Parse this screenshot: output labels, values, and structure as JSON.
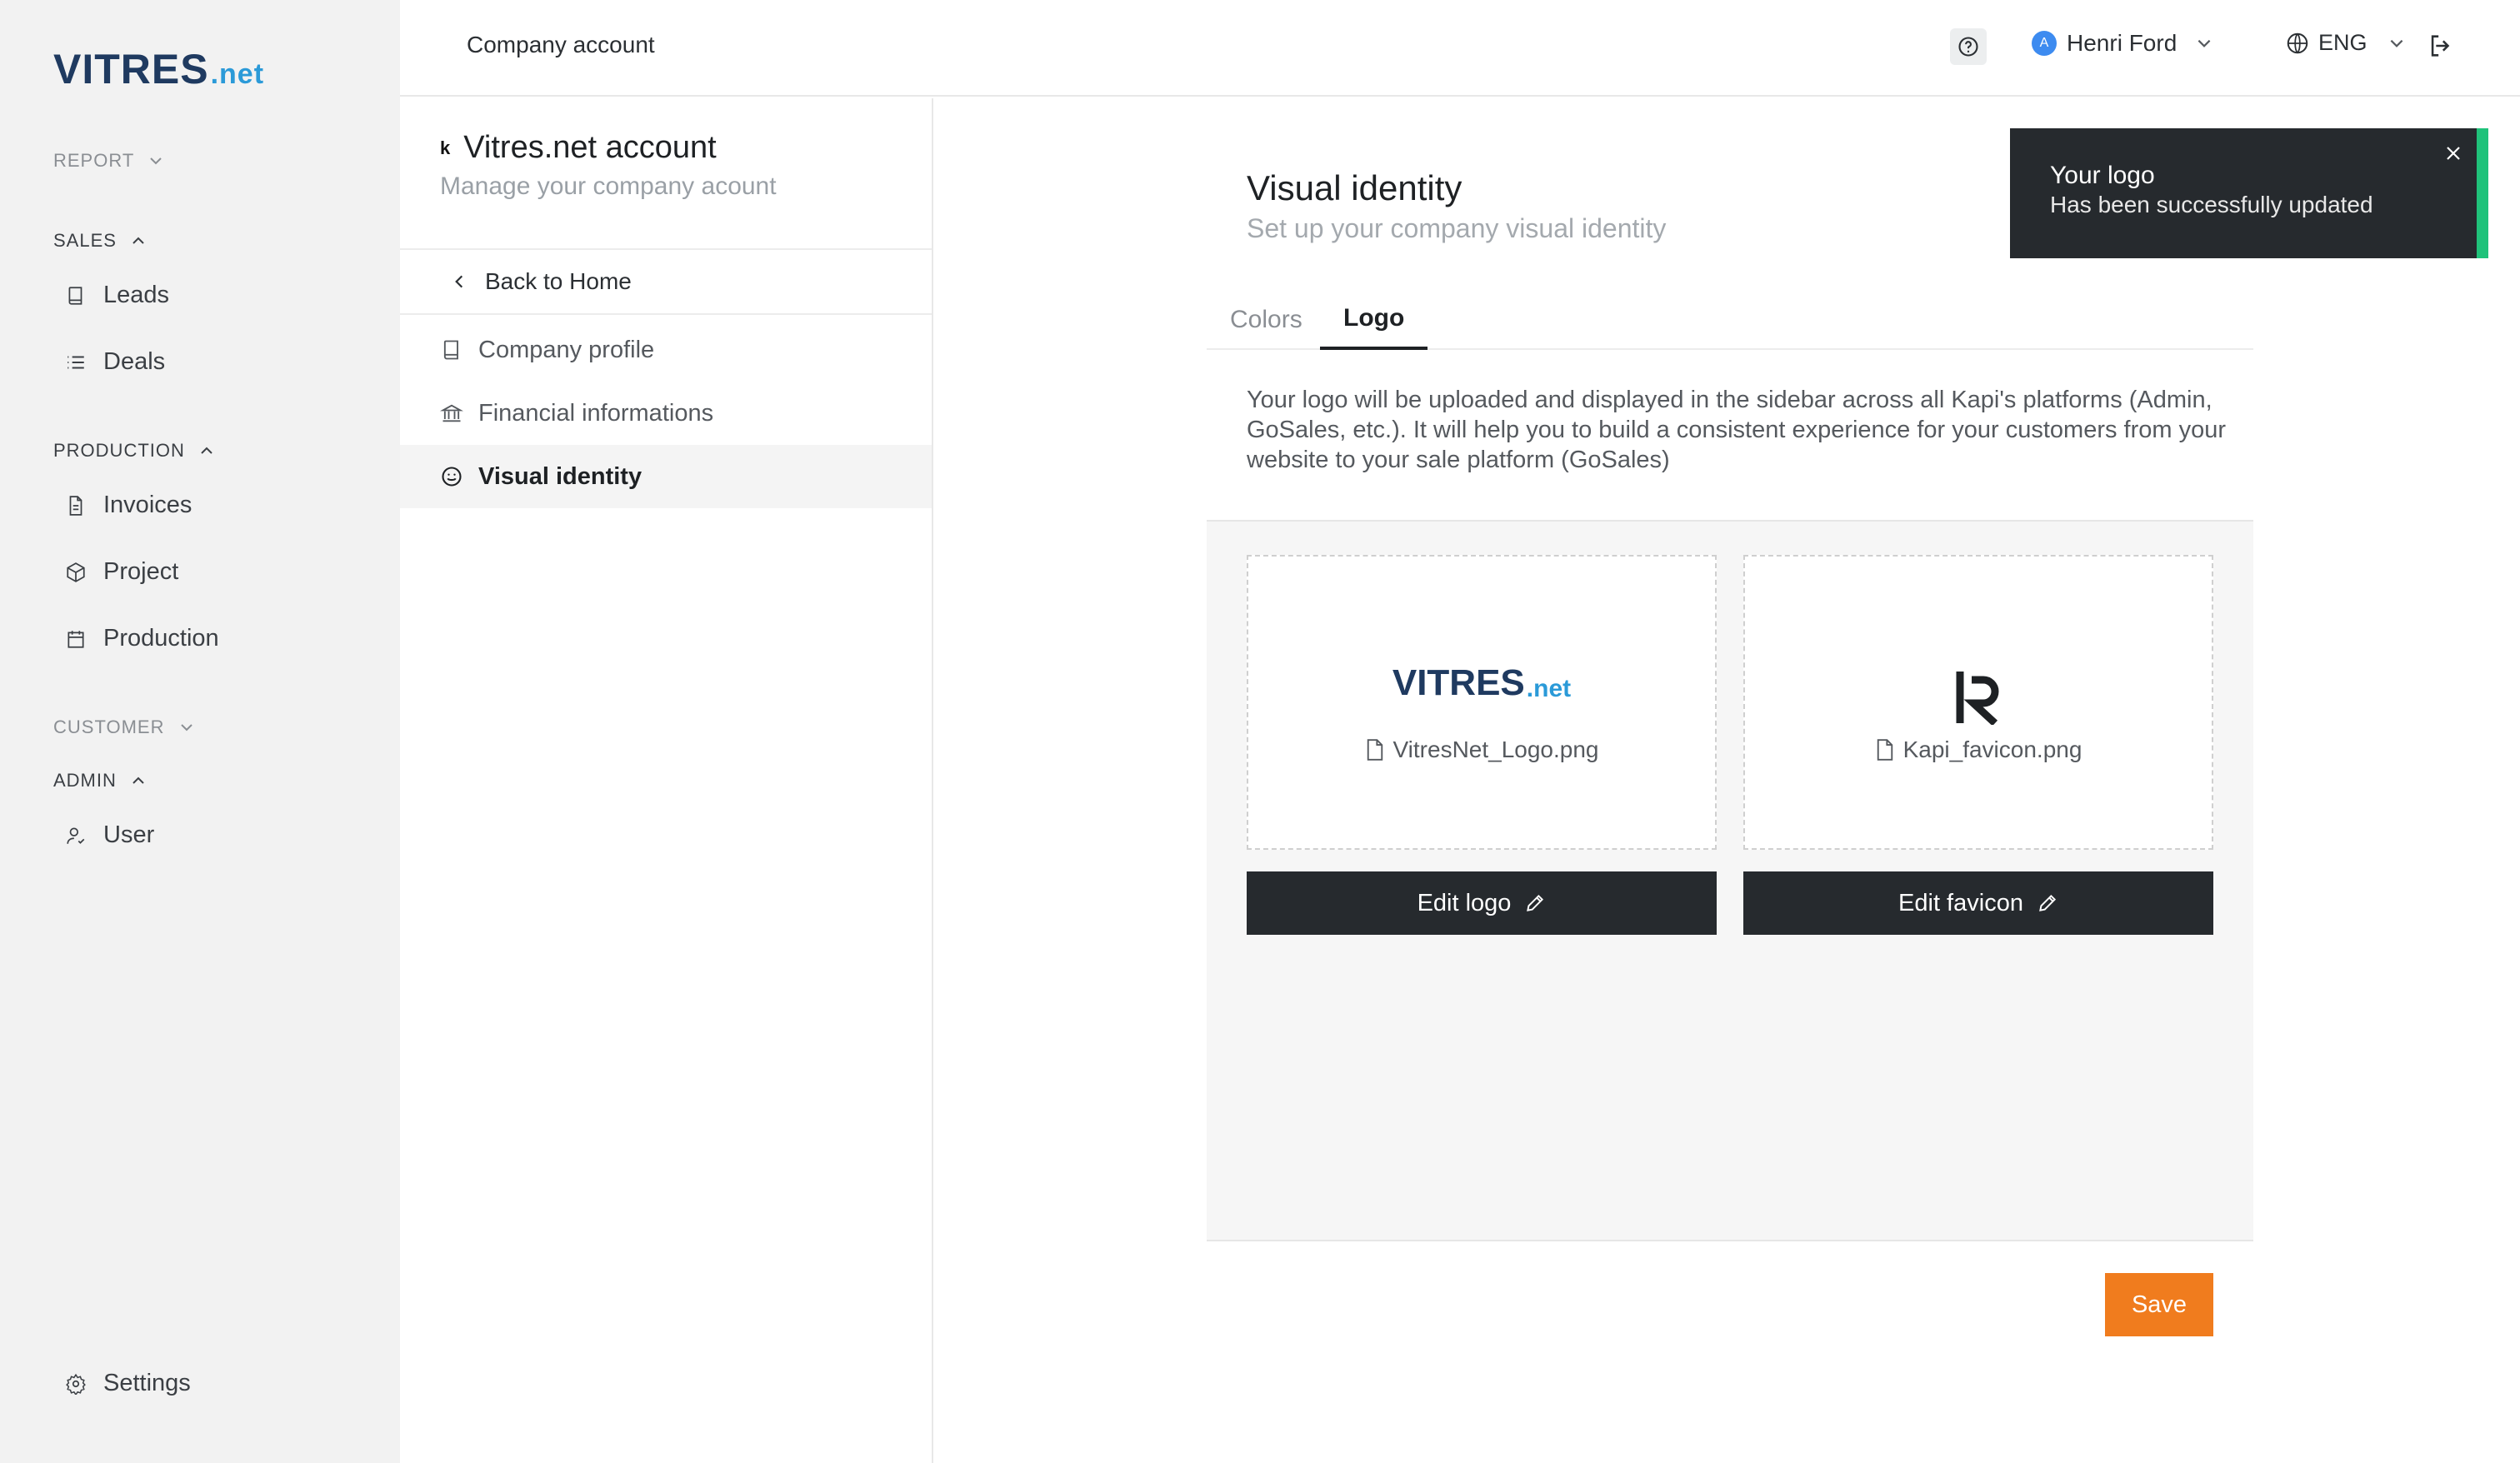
{
  "brand": {
    "main": "VITRES",
    "suffix": ".net"
  },
  "sidebar": {
    "sections": [
      {
        "title": "REPORT"
      },
      {
        "title": "SALES",
        "items": [
          {
            "label": "Leads",
            "icon": "book-icon"
          },
          {
            "label": "Deals",
            "icon": "list-icon"
          }
        ]
      },
      {
        "title": "PRODUCTION",
        "items": [
          {
            "label": "Invoices",
            "icon": "document-icon"
          },
          {
            "label": "Project",
            "icon": "cube-icon"
          },
          {
            "label": "Production",
            "icon": "calendar-icon"
          }
        ]
      },
      {
        "title": "CUSTOMER"
      },
      {
        "title": "ADMIN",
        "items": [
          {
            "label": "User",
            "icon": "user-icon"
          }
        ]
      }
    ],
    "settings_label": "Settings"
  },
  "topbar": {
    "title": "Company account",
    "user": {
      "initial": "A",
      "name": "Henri Ford"
    },
    "language": "ENG"
  },
  "account": {
    "logo_glyph": "k",
    "name": "Vitres.net account",
    "subtitle": "Manage your company acount",
    "back_label": "Back to Home",
    "menu": [
      {
        "label": "Company profile",
        "icon": "book-icon"
      },
      {
        "label": "Financial informations",
        "icon": "bank-icon"
      },
      {
        "label": "Visual identity",
        "icon": "smile-icon",
        "active": true
      }
    ]
  },
  "panel": {
    "title": "Visual identity",
    "subtitle": "Set up your company visual identity",
    "tabs": [
      {
        "label": "Colors"
      },
      {
        "label": "Logo",
        "active": true
      }
    ],
    "description": "Your logo will be uploaded and displayed in the sidebar across all Kapi's platforms (Admin, GoSales, etc.). It will help you to build a consistent experience for your customers from your website to your sale platform (GoSales)",
    "logo": {
      "preview_main": "VITRES",
      "preview_suffix": ".net",
      "filename": "VitresNet_Logo.png",
      "edit_label": "Edit logo"
    },
    "favicon": {
      "filename": "Kapi_favicon.png",
      "edit_label": "Edit favicon"
    },
    "save_label": "Save"
  },
  "toast": {
    "title": "Your logo",
    "message": "Has been successfully updated",
    "accent": "#1fc27a"
  },
  "colors": {
    "accent": "#f07c1e",
    "dark": "#262a2e",
    "brand_blue": "#2b9ad8",
    "brand_navy": "#1f3a60"
  }
}
